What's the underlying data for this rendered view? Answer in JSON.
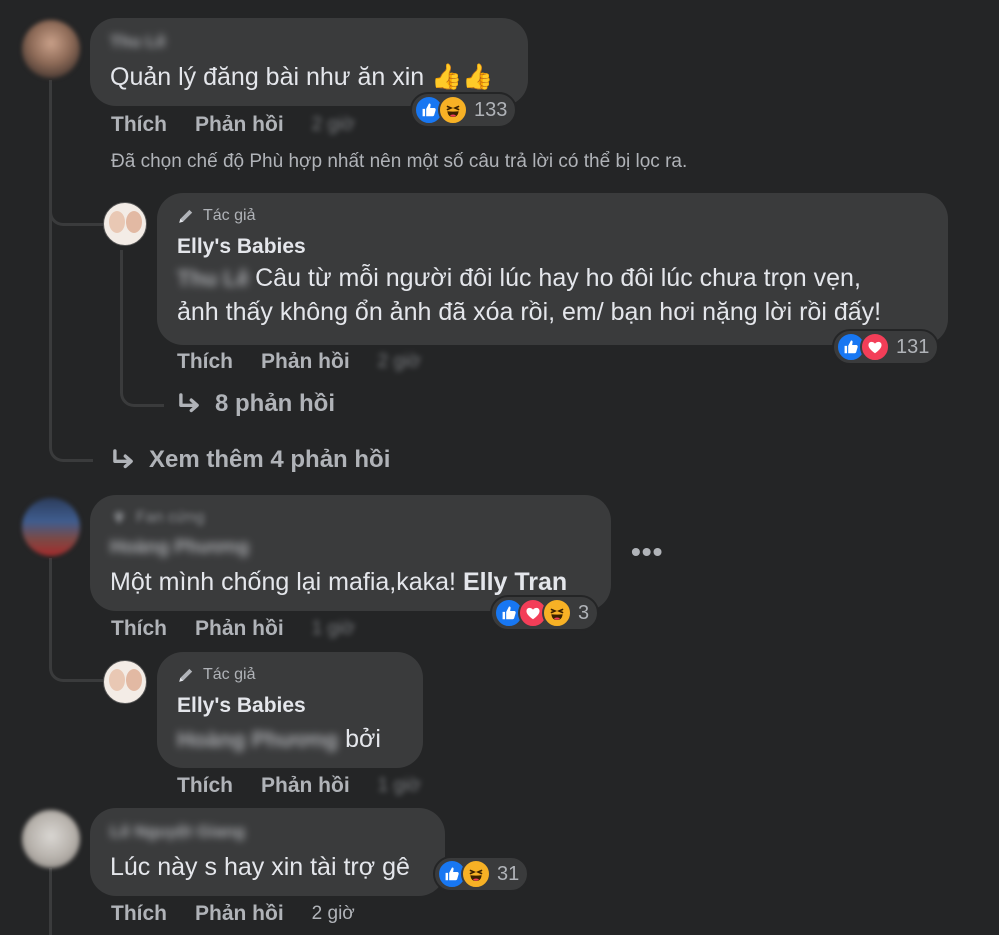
{
  "filter_note": "Đã chọn chế độ Phù hợp nhất nên một số câu trả lời có thể bị lọc ra.",
  "comments": [
    {
      "author": "Thu Lê",
      "text": "Quản lý đăng bài như ăn xin 👍👍",
      "reactions": {
        "count": "133"
      },
      "like_label": "Thích",
      "reply_label": "Phản hồi",
      "time": "2 giờ",
      "replies": [
        {
          "badge": "Tác giả",
          "author": "Elly's Babies",
          "mention": "Thu Lê",
          "line1": "Câu từ mỗi người đôi lúc hay ho đôi lúc chưa trọn vẹn,",
          "line2": "ảnh thấy không ổn ảnh đã xóa rồi, em/ bạn hơi nặng lời rồi đấy!",
          "reactions": {
            "count": "131"
          },
          "like_label": "Thích",
          "reply_label": "Phản hồi",
          "time": "2 giờ",
          "nested_replies_label": "8 phản hồi"
        }
      ],
      "see_more_label": "Xem thêm 4 phản hồi"
    },
    {
      "badge": "Fan cứng",
      "author": "Hoàng Phương",
      "text_before": "Một mình chống lại mafia,kaka! ",
      "mention": "Elly Tran",
      "reactions": {
        "count": "3"
      },
      "like_label": "Thích",
      "reply_label": "Phản hồi",
      "time": "1 giờ",
      "more_label": "•••",
      "replies": [
        {
          "badge": "Tác giả",
          "author": "Elly's Babies",
          "mention": "Hoàng Phương",
          "text_after": " bởi",
          "like_label": "Thích",
          "reply_label": "Phản hồi",
          "time": "1 giờ"
        }
      ]
    },
    {
      "author": "Lê Nguyệt Giang",
      "text": "Lúc này s hay xin tài trợ gê",
      "reactions": {
        "count": "31"
      },
      "like_label": "Thích",
      "reply_label": "Phản hồi",
      "time": "2 giờ"
    }
  ],
  "colors": {
    "background": "#242526",
    "bubble": "#3a3b3c",
    "like": "#1877f2",
    "love": "#f33e58",
    "haha": "#f7b125"
  }
}
